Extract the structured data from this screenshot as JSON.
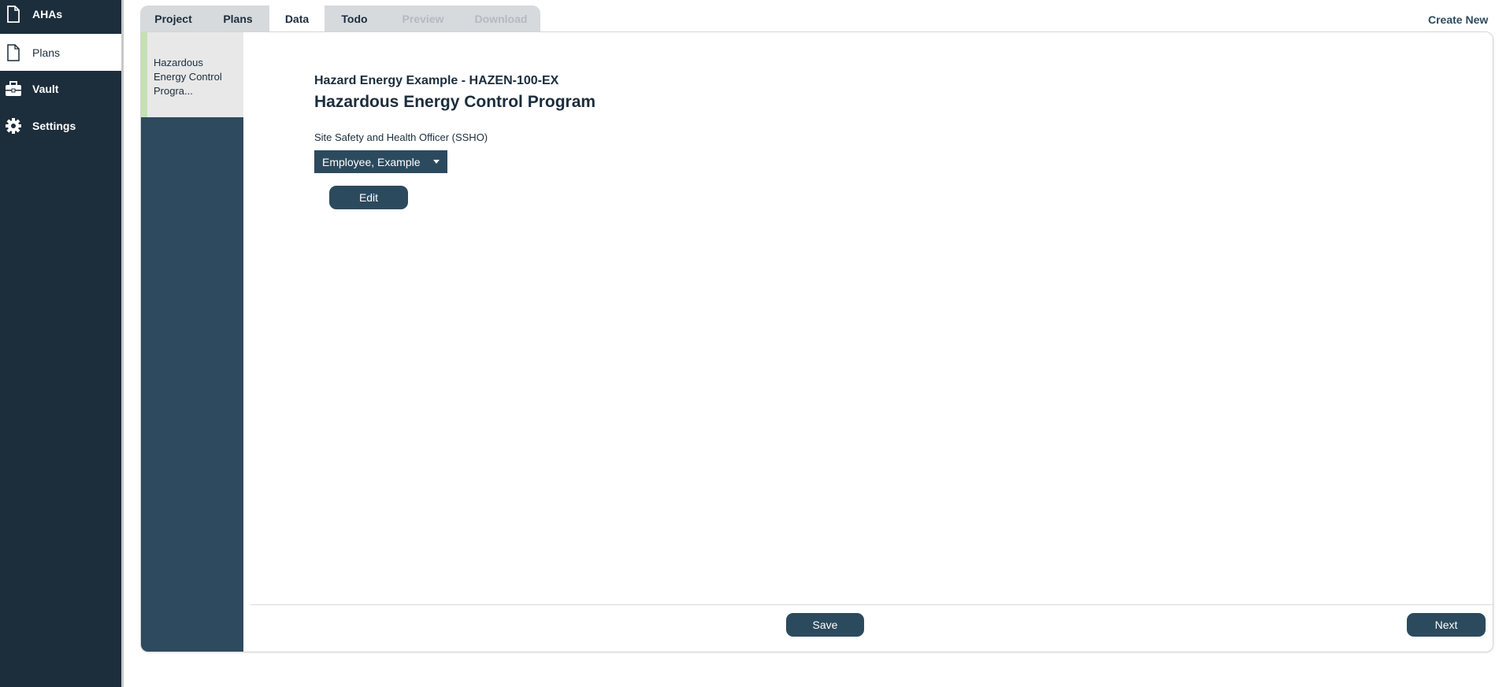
{
  "sidebar": {
    "items": [
      {
        "label": "AHAs",
        "icon": "document-icon"
      },
      {
        "label": "Plans",
        "icon": "document-icon",
        "active": true
      },
      {
        "label": "Vault",
        "icon": "briefcase-icon"
      },
      {
        "label": "Settings",
        "icon": "gear-icon"
      }
    ]
  },
  "tabs": [
    {
      "label": "Project"
    },
    {
      "label": "Plans"
    },
    {
      "label": "Data",
      "active": true
    },
    {
      "label": "Todo"
    },
    {
      "label": "Preview",
      "disabled": true
    },
    {
      "label": "Download",
      "disabled": true
    }
  ],
  "header": {
    "create_new": "Create New"
  },
  "plan_list": [
    {
      "label": "Hazardous Energy Control Progra..."
    }
  ],
  "main": {
    "subtitle": "Hazard Energy Example - HAZEN-100-EX",
    "title": "Hazardous Energy Control Program",
    "ssho_label": "Site Safety and Health Officer (SSHO)",
    "ssho_value": "Employee, Example",
    "edit": "Edit"
  },
  "footer": {
    "save": "Save",
    "next": "Next"
  },
  "colors": {
    "sidebar": "#1c2d3c",
    "accent": "#2c4a5e",
    "active_marker": "#c5e0b4"
  }
}
